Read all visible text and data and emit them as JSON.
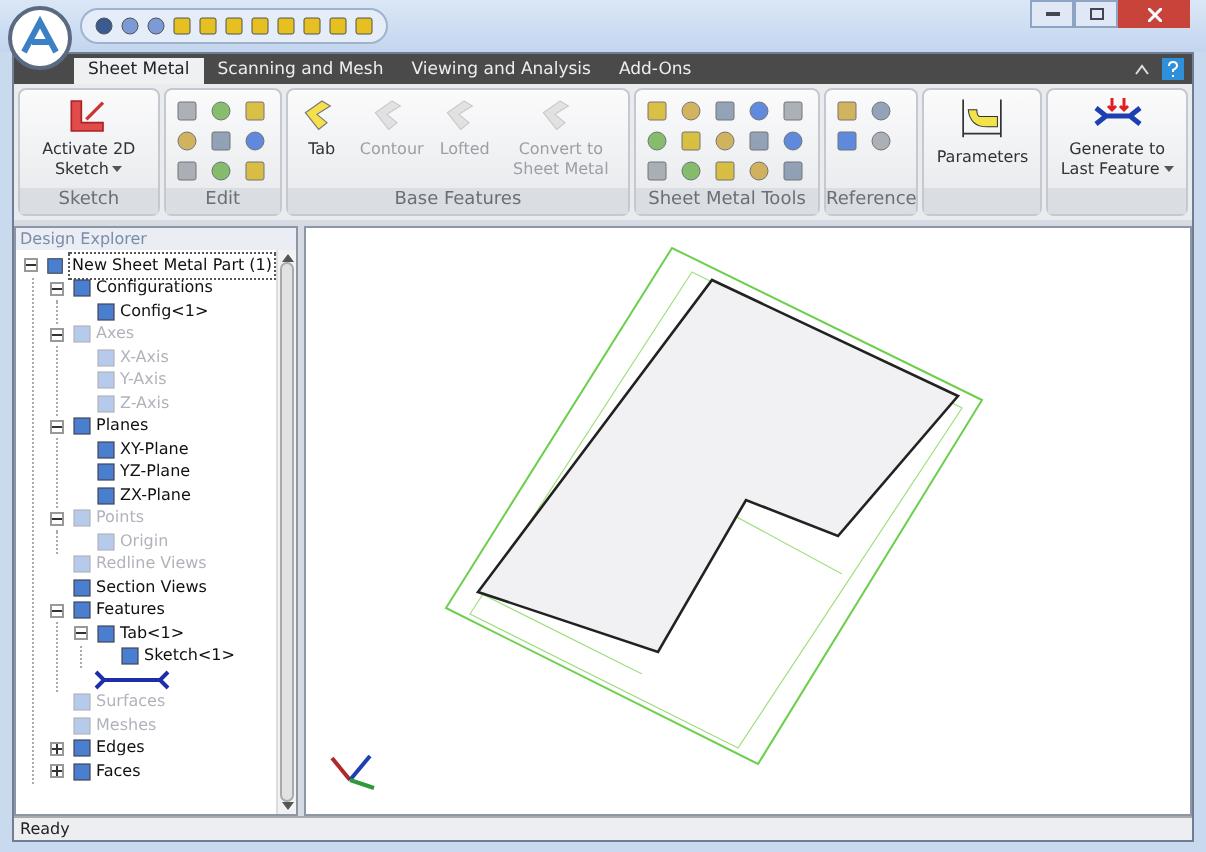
{
  "tabs": [
    {
      "label": "Sheet Metal",
      "selected": true
    },
    {
      "label": "Scanning and Mesh",
      "selected": false
    },
    {
      "label": "Viewing and Analysis",
      "selected": false
    },
    {
      "label": "Add-Ons",
      "selected": false
    }
  ],
  "ribbon": {
    "groups": [
      {
        "title": "Sketch",
        "kind": "large",
        "buttons": [
          {
            "label": "Activate 2D Sketch",
            "dropdown": true,
            "disabled": false
          }
        ]
      },
      {
        "title": "Edit",
        "kind": "small"
      },
      {
        "title": "Base Features",
        "kind": "large",
        "buttons": [
          {
            "label": "Tab",
            "dropdown": false,
            "disabled": false
          },
          {
            "label": "Contour",
            "dropdown": false,
            "disabled": true
          },
          {
            "label": "Lofted",
            "dropdown": false,
            "disabled": true
          },
          {
            "label": "Convert to Sheet Metal",
            "dropdown": false,
            "disabled": true
          }
        ]
      },
      {
        "title": "Sheet Metal Tools",
        "kind": "small"
      },
      {
        "title": "Reference",
        "kind": "small"
      },
      {
        "kind": "large",
        "buttons": [
          {
            "label": "Parameters",
            "dropdown": false,
            "disabled": false
          }
        ]
      },
      {
        "kind": "large",
        "buttons": [
          {
            "label": "Generate to Last Feature",
            "dropdown": true,
            "disabled": false
          }
        ]
      }
    ]
  },
  "explorer": {
    "title": "Design Explorer",
    "tree": [
      {
        "label": "New Sheet Metal Part (1)",
        "kind": "node",
        "expanded": true,
        "disabled": false,
        "children": [
          {
            "label": "Configurations",
            "kind": "node",
            "expanded": true,
            "disabled": false,
            "children": [
              {
                "label": "Config<1>",
                "kind": "node",
                "disabled": false
              }
            ]
          },
          {
            "label": "Axes",
            "kind": "node",
            "expanded": true,
            "disabled": true,
            "children": [
              {
                "label": "X-Axis",
                "kind": "node",
                "disabled": true
              },
              {
                "label": "Y-Axis",
                "kind": "node",
                "disabled": true
              },
              {
                "label": "Z-Axis",
                "kind": "node",
                "disabled": true
              }
            ]
          },
          {
            "label": "Planes",
            "kind": "node",
            "expanded": true,
            "disabled": false,
            "children": [
              {
                "label": "XY-Plane",
                "kind": "node",
                "disabled": false
              },
              {
                "label": "YZ-Plane",
                "kind": "node",
                "disabled": false
              },
              {
                "label": "ZX-Plane",
                "kind": "node",
                "disabled": false
              }
            ]
          },
          {
            "label": "Points",
            "kind": "node",
            "expanded": true,
            "disabled": true,
            "children": [
              {
                "label": "Origin",
                "kind": "node",
                "disabled": true
              }
            ]
          },
          {
            "label": "Redline Views",
            "kind": "node",
            "disabled": true
          },
          {
            "label": "Section Views",
            "kind": "node",
            "disabled": false
          },
          {
            "label": "Features",
            "kind": "node",
            "expanded": true,
            "disabled": false,
            "children": [
              {
                "label": "Tab<1>",
                "kind": "node",
                "expanded": true,
                "disabled": false,
                "children": [
                  {
                    "label": "Sketch<1>",
                    "kind": "node",
                    "disabled": false
                  }
                ]
              },
              {
                "kind": "marker"
              }
            ]
          },
          {
            "label": "Surfaces",
            "kind": "node",
            "disabled": true
          },
          {
            "label": "Meshes",
            "kind": "node",
            "disabled": true
          },
          {
            "label": "Edges",
            "kind": "node",
            "expanded": false,
            "disabled": false
          },
          {
            "label": "Faces",
            "kind": "node",
            "expanded": false,
            "disabled": false
          }
        ]
      }
    ]
  },
  "status_bar": {
    "text": "Ready"
  }
}
